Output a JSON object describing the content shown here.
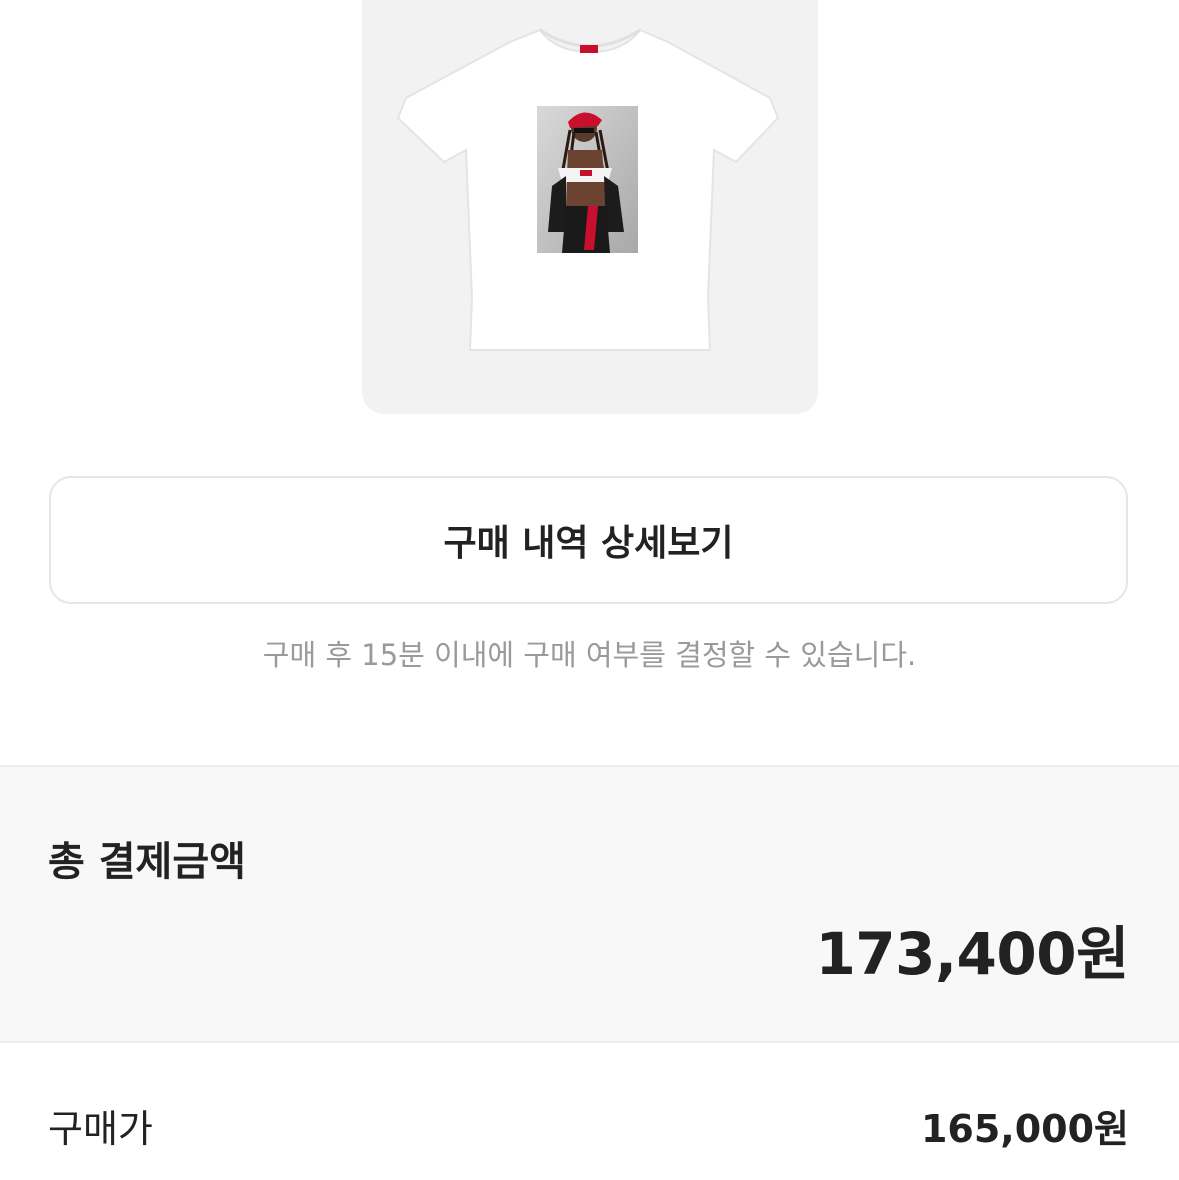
{
  "product": {
    "image_alt": "Supreme photo tee (white)"
  },
  "actions": {
    "purchase_history_label": "구매 내역 상세보기"
  },
  "notice": {
    "text": "구매 후 15분 이내에 구매 여부를 결정할 수 있습니다."
  },
  "total": {
    "label": "총 결제금액",
    "amount": "173,400원"
  },
  "breakdown": {
    "items": [
      {
        "label": "구매가",
        "value": "165,000원"
      }
    ]
  },
  "colors": {
    "accent_red": "#c8102e",
    "card_bg": "#f2f2f2",
    "section_bg": "#f8f8f8",
    "muted_text": "#9a9a9a"
  }
}
